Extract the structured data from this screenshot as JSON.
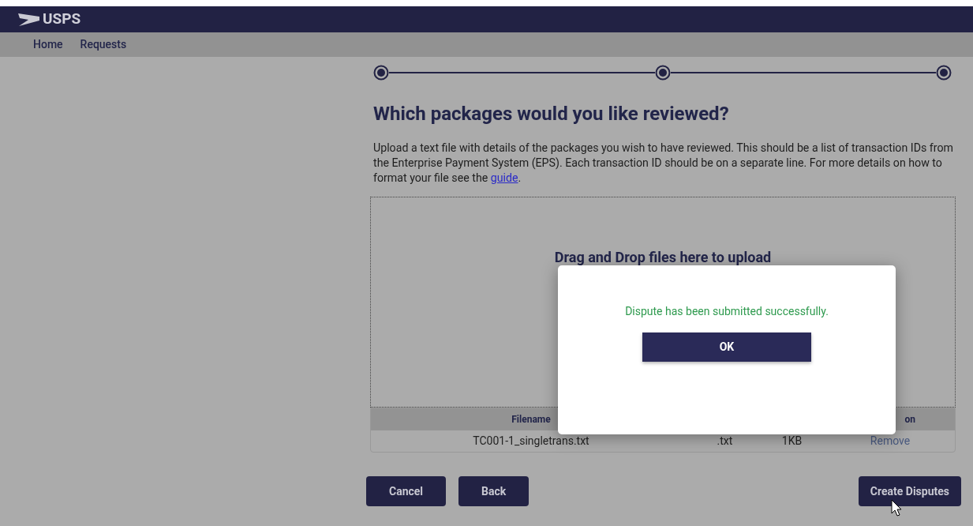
{
  "header": {
    "logo_text": "USPS"
  },
  "nav": {
    "items": [
      {
        "label": "Home"
      },
      {
        "label": "Requests"
      }
    ]
  },
  "stepper": {
    "steps": [
      {
        "done": true
      },
      {
        "done": true
      },
      {
        "done": true
      }
    ]
  },
  "heading": "Which packages would you like reviewed?",
  "intro": {
    "text": "Upload a text file with details of the packages you wish to have reviewed. This should be a list of transaction IDs from the Enterprise Payment System (EPS). Each transaction ID should be on a separate line. For more details on how to format your file see the ",
    "link": "guide",
    "after": "."
  },
  "dropzone": {
    "label": "Drag and Drop files here to upload"
  },
  "table": {
    "columns": [
      "Filename",
      "",
      "",
      "on"
    ],
    "rows": [
      {
        "cells": [
          "TC001-1_singletrans.txt",
          ".txt",
          "1KB"
        ],
        "action": "Remove"
      }
    ]
  },
  "buttons": {
    "left": [
      "Cancel",
      "Back"
    ],
    "right": "Create Disputes"
  },
  "modal": {
    "message": "Dispute has been submitted successfully.",
    "button": "OK"
  }
}
